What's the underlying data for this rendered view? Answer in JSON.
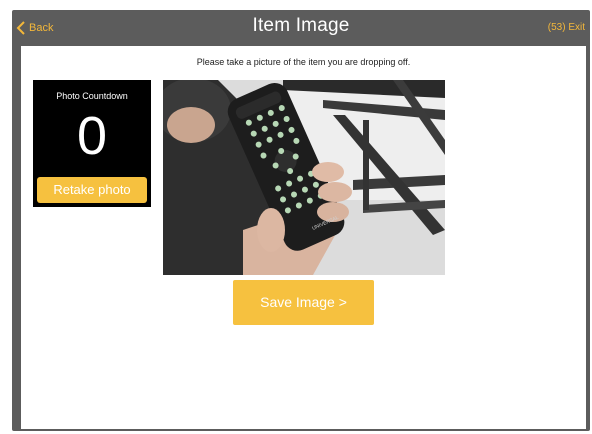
{
  "header": {
    "back_label": "Back",
    "title": "Item Image",
    "exit_label": "(53) Exit"
  },
  "instruction": "Please take a picture of the item you are dropping off.",
  "countdown": {
    "label": "Photo Countdown",
    "value": "0",
    "retake_label": "Retake photo"
  },
  "photo": {
    "remote_brand": "UNIVERSAL"
  },
  "save_label": "Save Image >",
  "colors": {
    "accent": "#f6c13f",
    "header_bg": "#5c5c5c"
  }
}
